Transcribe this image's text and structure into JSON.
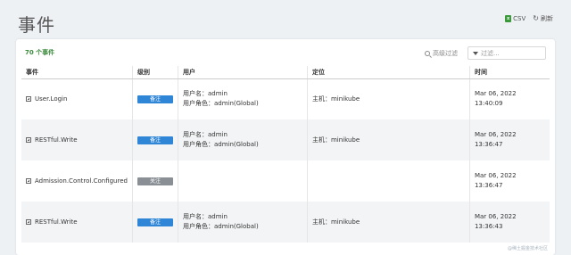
{
  "page": {
    "title": "事件"
  },
  "toolbar": {
    "csv_label": "CSV",
    "refresh_label": "刷新"
  },
  "summary": {
    "count_text": "70 个事件"
  },
  "filter": {
    "advanced_label": "高级过滤",
    "placeholder": "过滤..."
  },
  "table": {
    "headers": [
      "事件",
      "级别",
      "用户",
      "定位",
      "时间"
    ],
    "rows": [
      {
        "event": "User.Login",
        "level": "备注",
        "level_kind": "note",
        "user_name": "用户名：admin",
        "user_role": "用户角色：admin(Global)",
        "location": "主机：minikube",
        "time": "Mar 06, 2022 13:40:09"
      },
      {
        "event": "RESTful.Write",
        "level": "备注",
        "level_kind": "note",
        "user_name": "用户名：admin",
        "user_role": "用户角色：admin(Global)",
        "location": "主机：minikube",
        "time": "Mar 06, 2022 13:36:47"
      },
      {
        "event": "Admission.Control.Configured",
        "level": "关注",
        "level_kind": "focus",
        "user_name": "",
        "user_role": "",
        "location": "",
        "time": "Mar 06, 2022 13:36:47"
      },
      {
        "event": "RESTful.Write",
        "level": "备注",
        "level_kind": "note",
        "user_name": "用户名：admin",
        "user_role": "用户角色：admin(Global)",
        "location": "主机：minikube",
        "time": "Mar 06, 2022 13:36:43"
      }
    ]
  },
  "watermark": "@稀土掘金技术社区",
  "colors": {
    "note": "#2f86d6",
    "focus": "#8a8f96",
    "count": "#3d8c3d"
  }
}
